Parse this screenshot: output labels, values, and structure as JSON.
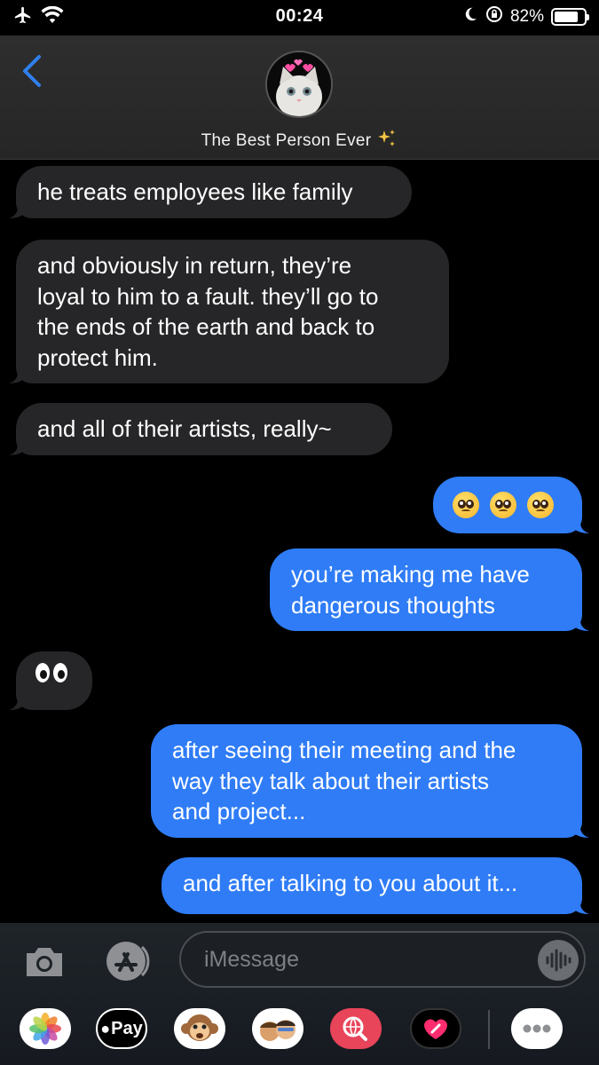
{
  "status_bar": {
    "time": "00:24",
    "battery": "82%",
    "battery_level": 0.82
  },
  "header": {
    "contact_name": "The Best Person Ever"
  },
  "messages": [
    {
      "direction": "incoming",
      "text": "he treats employees like family"
    },
    {
      "direction": "incoming",
      "lines": [
        "and obviously in return, they’re",
        "loyal to him to a fault. they’ll go to",
        "the ends of the earth and back to",
        "protect him."
      ]
    },
    {
      "direction": "incoming",
      "text": "and all of their artists, really~"
    },
    {
      "direction": "outgoing",
      "emoji": "pleading-face-x3"
    },
    {
      "direction": "outgoing",
      "lines": [
        "you’re making me have",
        "dangerous thoughts"
      ]
    },
    {
      "direction": "incoming",
      "emoji": "eyes"
    },
    {
      "direction": "outgoing",
      "lines": [
        "after seeing their meeting and the",
        "way they talk about their artists",
        "and project..."
      ]
    },
    {
      "direction": "outgoing",
      "text": "and after talking to you about it..."
    }
  ],
  "compose": {
    "placeholder": "iMessage"
  },
  "app_drawer": {
    "items": [
      "photos",
      "apple-pay",
      "animoji",
      "memoji-stickers",
      "web-search",
      "digital-touch",
      "more"
    ],
    "apple_pay_label": "Pay"
  },
  "colors": {
    "outgoing_bubble": "#2f7cf6",
    "incoming_bubble": "#262628",
    "accent": "#2f80ed"
  }
}
